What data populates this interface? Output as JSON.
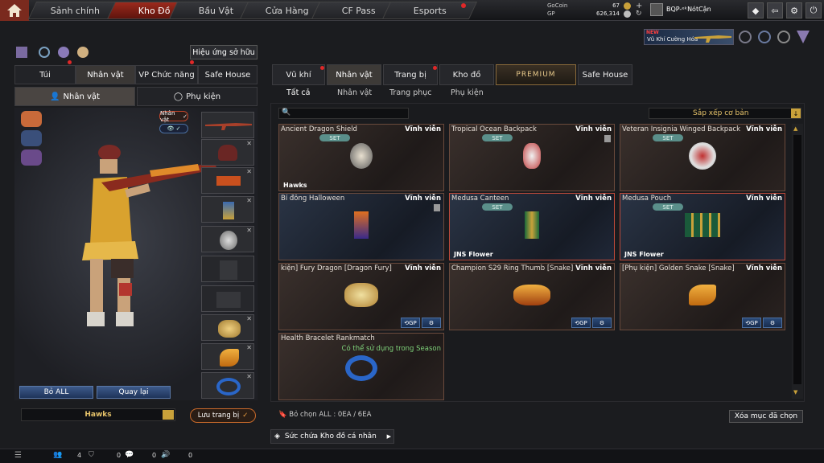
{
  "topbar": {
    "tabs": [
      "Sảnh chính",
      "Kho Đồ",
      "Bầu Vật",
      "Cửa Hàng",
      "CF Pass",
      "Esports"
    ],
    "currency": [
      {
        "name": "GoCoin",
        "value": "67"
      },
      {
        "name": "GP",
        "value": "626,314"
      }
    ],
    "username": "BQP-ᵉᵏNótCận"
  },
  "banner": {
    "badge": "NEW",
    "text": "Vũ Khí Cường Hóa"
  },
  "left": {
    "effects_button": "Hiệu ứng sở hữu",
    "tabs": [
      "Túi",
      "Nhân vật",
      "VP Chức năng",
      "Safe House"
    ],
    "subtabs": [
      "Nhân vật",
      "Phụ kiện"
    ],
    "character_toggle": "Nhân vật",
    "remove_all": "Bỏ ALL",
    "back": "Quay lại",
    "name_value": "Hawks",
    "save_outfit": "Lưu trang bị"
  },
  "right": {
    "tabs": [
      "Vũ khí",
      "Nhân vật",
      "Trang bị",
      "Kho đồ",
      "PREMIUM",
      "Safe House"
    ],
    "subtabs": [
      "Tất cả",
      "Nhân vật",
      "Trang phục",
      "Phụ kiện"
    ],
    "search_placeholder": "",
    "sort": "Sắp xếp cơ bản",
    "items": [
      {
        "name": "Ancient Dragon Shield",
        "duration": "Vĩnh viễn",
        "set": "SET",
        "owner": "Hawks"
      },
      {
        "name": "Tropical Ocean Backpack",
        "duration": "Vĩnh viễn",
        "set": "SET"
      },
      {
        "name": "Veteran Insignia Winged Backpack",
        "duration": "Vĩnh viễn",
        "set": "SET"
      },
      {
        "name": "Bí đông Halloween",
        "duration": "Vĩnh viễn"
      },
      {
        "name": "Medusa Canteen",
        "duration": "Vĩnh viễn",
        "set": "SET",
        "owner": "JNS Flower"
      },
      {
        "name": "Medusa Pouch",
        "duration": "Vĩnh viễn",
        "set": "SET",
        "owner": "JNS Flower"
      },
      {
        "name": "kiện] Fury Dragon [Dragon Fury]",
        "duration": "Vĩnh viễn"
      },
      {
        "name": "Champion S29 Ring Thumb [Snake]",
        "duration": "Vĩnh viễn"
      },
      {
        "name": "[Phụ kiện] Golden Snake [Snake]",
        "duration": "Vĩnh viễn"
      },
      {
        "name": "Health Bracelet Rankmatch",
        "duration": "",
        "note": "Có thể sử dụng trong Season"
      }
    ],
    "selected_count": "Bỏ chọn ALL : 0EA / 6EA",
    "clear_button": "Xóa mục đã chọn",
    "capacity": "Sức chứa Kho đồ cá nhân"
  },
  "bottombar": {
    "counts": [
      "4",
      "0",
      "0",
      "0"
    ]
  },
  "colors": {
    "accent_red": "#9b2a1d",
    "card_border": "#6a4a3c",
    "button_blue": "#2b4a78",
    "highlight_green": "#7fd27a"
  }
}
